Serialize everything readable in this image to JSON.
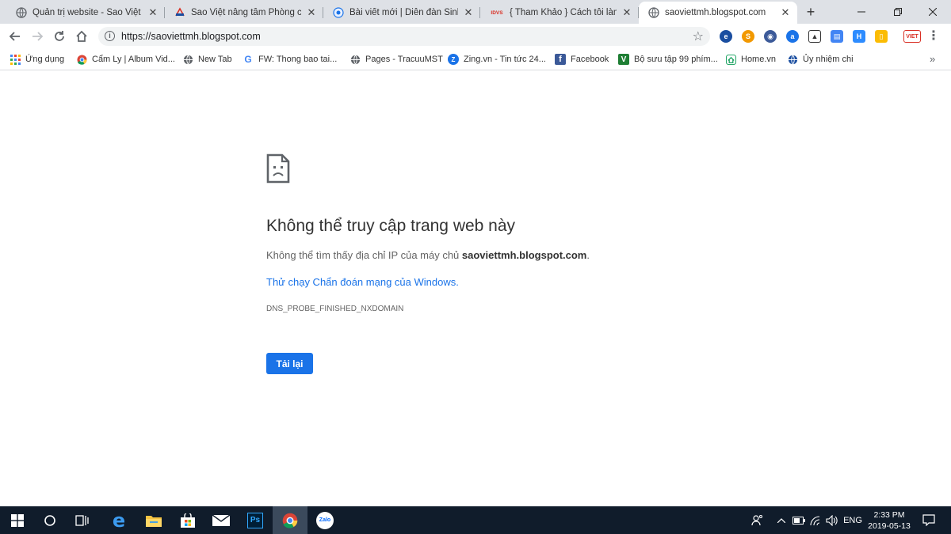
{
  "tabs": [
    {
      "title": "Quản trị website - Sao Việt",
      "icon": "globe-icon",
      "active": false
    },
    {
      "title": "Sao Việt nâng tầm Phòng cháy",
      "icon": "saoviet-logo-icon",
      "active": false
    },
    {
      "title": "Bài viết mới | Diễn đàn Sinh Viê",
      "icon": "forum-icon",
      "active": false
    },
    {
      "title": "{ Tham Khảo } Cách tôi làm seo",
      "icon": "idvs-icon",
      "favicon_text": "IDVS",
      "active": false
    },
    {
      "title": "saoviettmh.blogspot.com",
      "icon": "globe-icon",
      "active": true
    }
  ],
  "tab_close_glyph": "✕",
  "new_tab_glyph": "+",
  "window_controls": [
    "minimize-icon",
    "maximize-icon",
    "close-icon"
  ],
  "omnibox": {
    "url": "https://saoviettmh.blogspot.com",
    "icon": "info-icon"
  },
  "extensions": [
    "e-ext-icon",
    "sao-ext-icon",
    "user-ext-icon",
    "a-ext-icon",
    "image-ext-icon",
    "reader-ext-icon",
    "h-ext-icon",
    "note-ext-icon",
    "viet-ext-icon"
  ],
  "extension_texts": {
    "viet": "VIET"
  },
  "bookmarks": [
    {
      "label": "Ứng dụng",
      "icon": "apps-grid-icon"
    },
    {
      "label": "Cẩm Ly | Album Vid...",
      "icon": "chrome-icon"
    },
    {
      "label": "New Tab",
      "icon": "globe-icon"
    },
    {
      "label": "FW: Thong bao tai...",
      "icon": "google-icon"
    },
    {
      "label": "Pages - TracuuMST",
      "icon": "globe-icon"
    },
    {
      "label": "Zing.vn - Tin tức 24...",
      "icon": "zing-icon"
    },
    {
      "label": "Facebook",
      "icon": "facebook-icon"
    },
    {
      "label": "Bộ sưu tập 99 phím...",
      "icon": "v-icon"
    },
    {
      "label": "Home.vn",
      "icon": "home-icon"
    },
    {
      "label": "Ủy nhiệm chi",
      "icon": "globe-icon"
    }
  ],
  "bookmarks_more": "»",
  "error": {
    "title": "Không thể truy cập trang web này",
    "message_prefix": "Không thể tìm thấy địa chỉ IP của máy chủ ",
    "message_host": "saoviettmh.blogspot.com",
    "message_suffix": ".",
    "diagnostics_link": "Thử chạy Chẩn đoán mạng của Windows.",
    "code": "DNS_PROBE_FINISHED_NXDOMAIN",
    "reload_label": "Tải lại"
  },
  "taskbar": {
    "apps": [
      "windows-start-icon",
      "search-circle-icon",
      "task-view-icon",
      "edge-icon",
      "file-explorer-icon",
      "store-icon",
      "mail-icon",
      "photoshop-icon",
      "chrome-icon",
      "zalo-icon"
    ],
    "photoshop_text": "Ps",
    "zalo_text": "Zalo",
    "tray": {
      "language": "ENG",
      "time": "2:33 PM",
      "date": "2019-05-13"
    }
  },
  "colors": {
    "accent": "#1a73e8",
    "taskbar": "#101c2b",
    "tabstrip": "#dee1e6"
  }
}
